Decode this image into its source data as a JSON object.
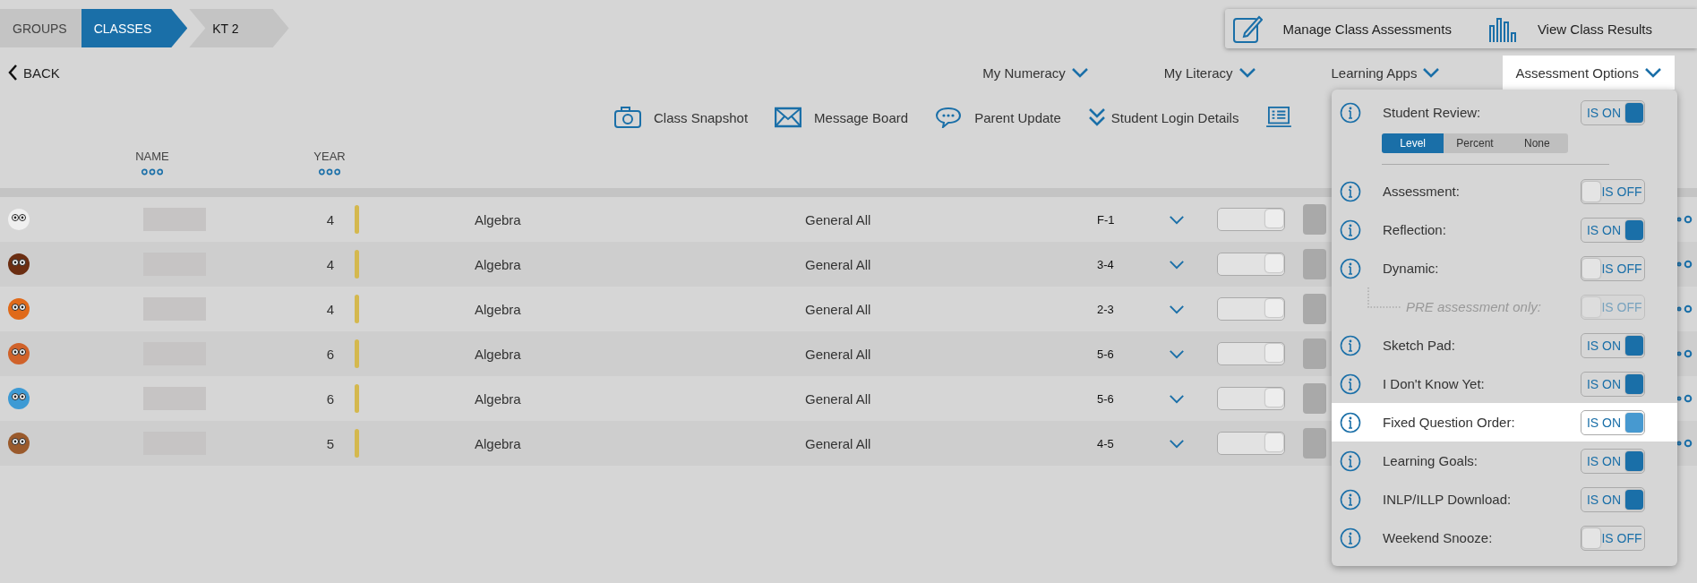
{
  "breadcrumb": [
    {
      "label": "GROUPS",
      "selected": false
    },
    {
      "label": "CLASSES",
      "selected": true
    },
    {
      "label": "KT 2",
      "selected": false
    }
  ],
  "back": "BACK",
  "top_actions": [
    "Manage Class Assessments",
    "View Class Results"
  ],
  "menus": [
    {
      "label": "My Numeracy",
      "selected": false
    },
    {
      "label": "My Literacy",
      "selected": false
    },
    {
      "label": "Learning Apps",
      "selected": false
    },
    {
      "label": "Assessment Options",
      "selected": true
    }
  ],
  "toolbar": [
    "Class Snapshot",
    "Message Board",
    "Parent Update",
    "Student Login Details"
  ],
  "columns": [
    "NAME",
    "YEAR"
  ],
  "rows": [
    {
      "color": "#f0f0f0",
      "year": "4",
      "subject": "Algebra",
      "group": "General All",
      "range": "F-1",
      "switch_on": true
    },
    {
      "color": "#6b2e12",
      "year": "4",
      "subject": "Algebra",
      "group": "General All",
      "range": "3-4",
      "switch_on": true
    },
    {
      "color": "#e06a1a",
      "year": "4",
      "subject": "Algebra",
      "group": "General All",
      "range": "2-3",
      "switch_on": true
    },
    {
      "color": "#d0622a",
      "year": "6",
      "subject": "Algebra",
      "group": "General All",
      "range": "5-6",
      "switch_on": true
    },
    {
      "color": "#3d9ad4",
      "year": "6",
      "subject": "Algebra",
      "group": "General All",
      "range": "5-6",
      "switch_on": true
    },
    {
      "color": "#9a5a2c",
      "year": "5",
      "subject": "Algebra",
      "group": "General All",
      "range": "4-5",
      "switch_on": true
    }
  ],
  "options": [
    {
      "kind": "toggle",
      "label": "Student Review:",
      "on": true,
      "status": "IS ON",
      "highlighted": false
    },
    {
      "kind": "segmented",
      "segments": [
        {
          "label": "Level",
          "selected": true
        },
        {
          "label": "Percent",
          "selected": false
        },
        {
          "label": "None",
          "selected": false
        }
      ]
    },
    {
      "kind": "toggle",
      "label": "Assessment:",
      "on": false,
      "status": "IS OFF",
      "highlighted": false
    },
    {
      "kind": "toggle",
      "label": "Reflection:",
      "on": true,
      "status": "IS ON",
      "highlighted": false
    },
    {
      "kind": "toggle",
      "label": "Dynamic:",
      "on": false,
      "status": "IS OFF",
      "highlighted": false
    },
    {
      "kind": "sub",
      "label": "PRE assessment only:",
      "on": false,
      "status": "IS OFF",
      "disabled": true
    },
    {
      "kind": "toggle",
      "label": "Sketch Pad:",
      "on": true,
      "status": "IS ON",
      "highlighted": false
    },
    {
      "kind": "toggle",
      "label": "I Don't Know Yet:",
      "on": true,
      "status": "IS ON",
      "highlighted": false
    },
    {
      "kind": "toggle",
      "label": "Fixed Question Order:",
      "on": true,
      "status": "IS ON",
      "highlighted": true
    },
    {
      "kind": "toggle",
      "label": "Learning Goals:",
      "on": true,
      "status": "IS ON",
      "highlighted": false
    },
    {
      "kind": "toggle",
      "label": "INLP/ILLP Download:",
      "on": true,
      "status": "IS ON",
      "highlighted": false
    },
    {
      "kind": "toggle",
      "label": "Weekend Snooze:",
      "on": false,
      "status": "IS OFF",
      "highlighted": false
    }
  ]
}
